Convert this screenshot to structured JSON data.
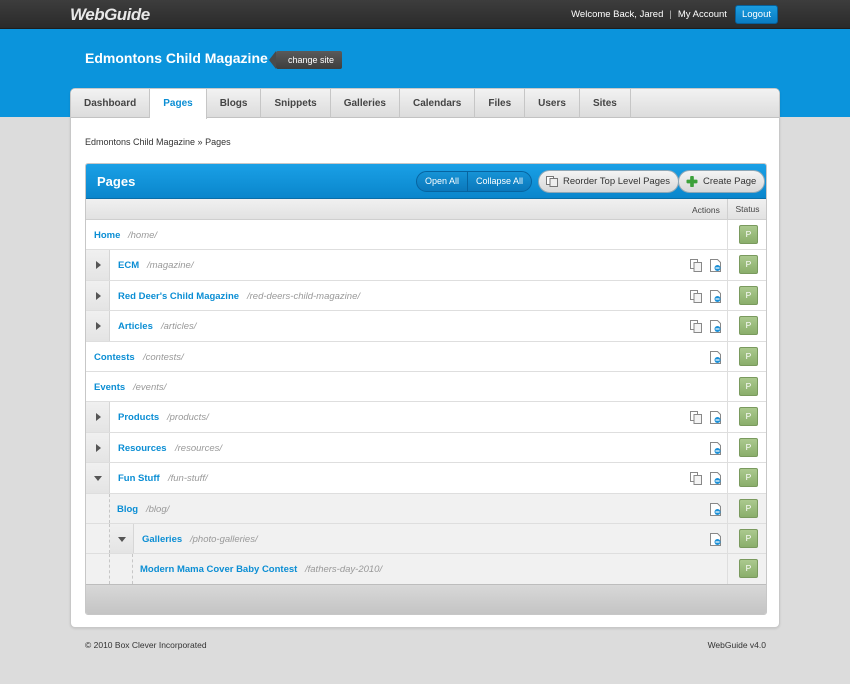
{
  "topbar": {
    "logo": "WebGuide",
    "welcome": "Welcome Back, Jared",
    "separator": "|",
    "my_account": "My Account",
    "logout": "Logout"
  },
  "header": {
    "site_title": "Edmontons Child Magazine",
    "change_site": "change site"
  },
  "tabs": [
    {
      "label": "Dashboard",
      "active": false
    },
    {
      "label": "Pages",
      "active": true
    },
    {
      "label": "Blogs",
      "active": false
    },
    {
      "label": "Snippets",
      "active": false
    },
    {
      "label": "Galleries",
      "active": false
    },
    {
      "label": "Calendars",
      "active": false
    },
    {
      "label": "Files",
      "active": false
    },
    {
      "label": "Users",
      "active": false
    },
    {
      "label": "Sites",
      "active": false
    }
  ],
  "breadcrumb": "Edmontons Child Magazine » Pages",
  "pages_panel": {
    "title": "Pages",
    "open_all": "Open All",
    "collapse_all": "Collapse All",
    "reorder": "Reorder Top Level Pages",
    "create": "Create Page",
    "col_actions": "Actions",
    "col_status": "Status"
  },
  "rows": [
    {
      "name": "Home",
      "path": "/home/",
      "level": 0,
      "expander": "none",
      "copy": false,
      "edit": false,
      "status": "P"
    },
    {
      "name": "ECM",
      "path": "/magazine/",
      "level": 0,
      "expander": "collapsed",
      "copy": true,
      "edit": true,
      "status": "P"
    },
    {
      "name": "Red Deer's Child Magazine",
      "path": "/red-deers-child-magazine/",
      "level": 0,
      "expander": "collapsed",
      "copy": true,
      "edit": true,
      "status": "P"
    },
    {
      "name": "Articles",
      "path": "/articles/",
      "level": 0,
      "expander": "collapsed",
      "copy": true,
      "edit": true,
      "status": "P"
    },
    {
      "name": "Contests",
      "path": "/contests/",
      "level": 0,
      "expander": "none",
      "copy": false,
      "edit": true,
      "status": "P"
    },
    {
      "name": "Events",
      "path": "/events/",
      "level": 0,
      "expander": "none",
      "copy": false,
      "edit": false,
      "status": "P"
    },
    {
      "name": "Products",
      "path": "/products/",
      "level": 0,
      "expander": "collapsed",
      "copy": true,
      "edit": true,
      "status": "P"
    },
    {
      "name": "Resources",
      "path": "/resources/",
      "level": 0,
      "expander": "collapsed",
      "copy": false,
      "edit": true,
      "status": "P"
    },
    {
      "name": "Fun Stuff",
      "path": "/fun-stuff/",
      "level": 0,
      "expander": "expanded",
      "copy": true,
      "edit": true,
      "status": "P"
    },
    {
      "name": "Blog",
      "path": "/blog/",
      "level": 1,
      "expander": "none",
      "copy": false,
      "edit": true,
      "status": "P"
    },
    {
      "name": "Galleries",
      "path": "/photo-galleries/",
      "level": 1,
      "expander": "expanded",
      "copy": false,
      "edit": true,
      "status": "P"
    },
    {
      "name": "Modern Mama Cover Baby Contest",
      "path": "/fathers-day-2010/",
      "level": 2,
      "expander": "none",
      "copy": false,
      "edit": false,
      "status": "P"
    }
  ],
  "footer": {
    "copyright": "© 2010 Box Clever Incorporated",
    "version": "WebGuide v4.0"
  },
  "colors": {
    "brand_blue": "#0b94dc",
    "link_blue": "#0b8ed4",
    "status_green": "#9bbd7c",
    "topbar": "#333333"
  }
}
